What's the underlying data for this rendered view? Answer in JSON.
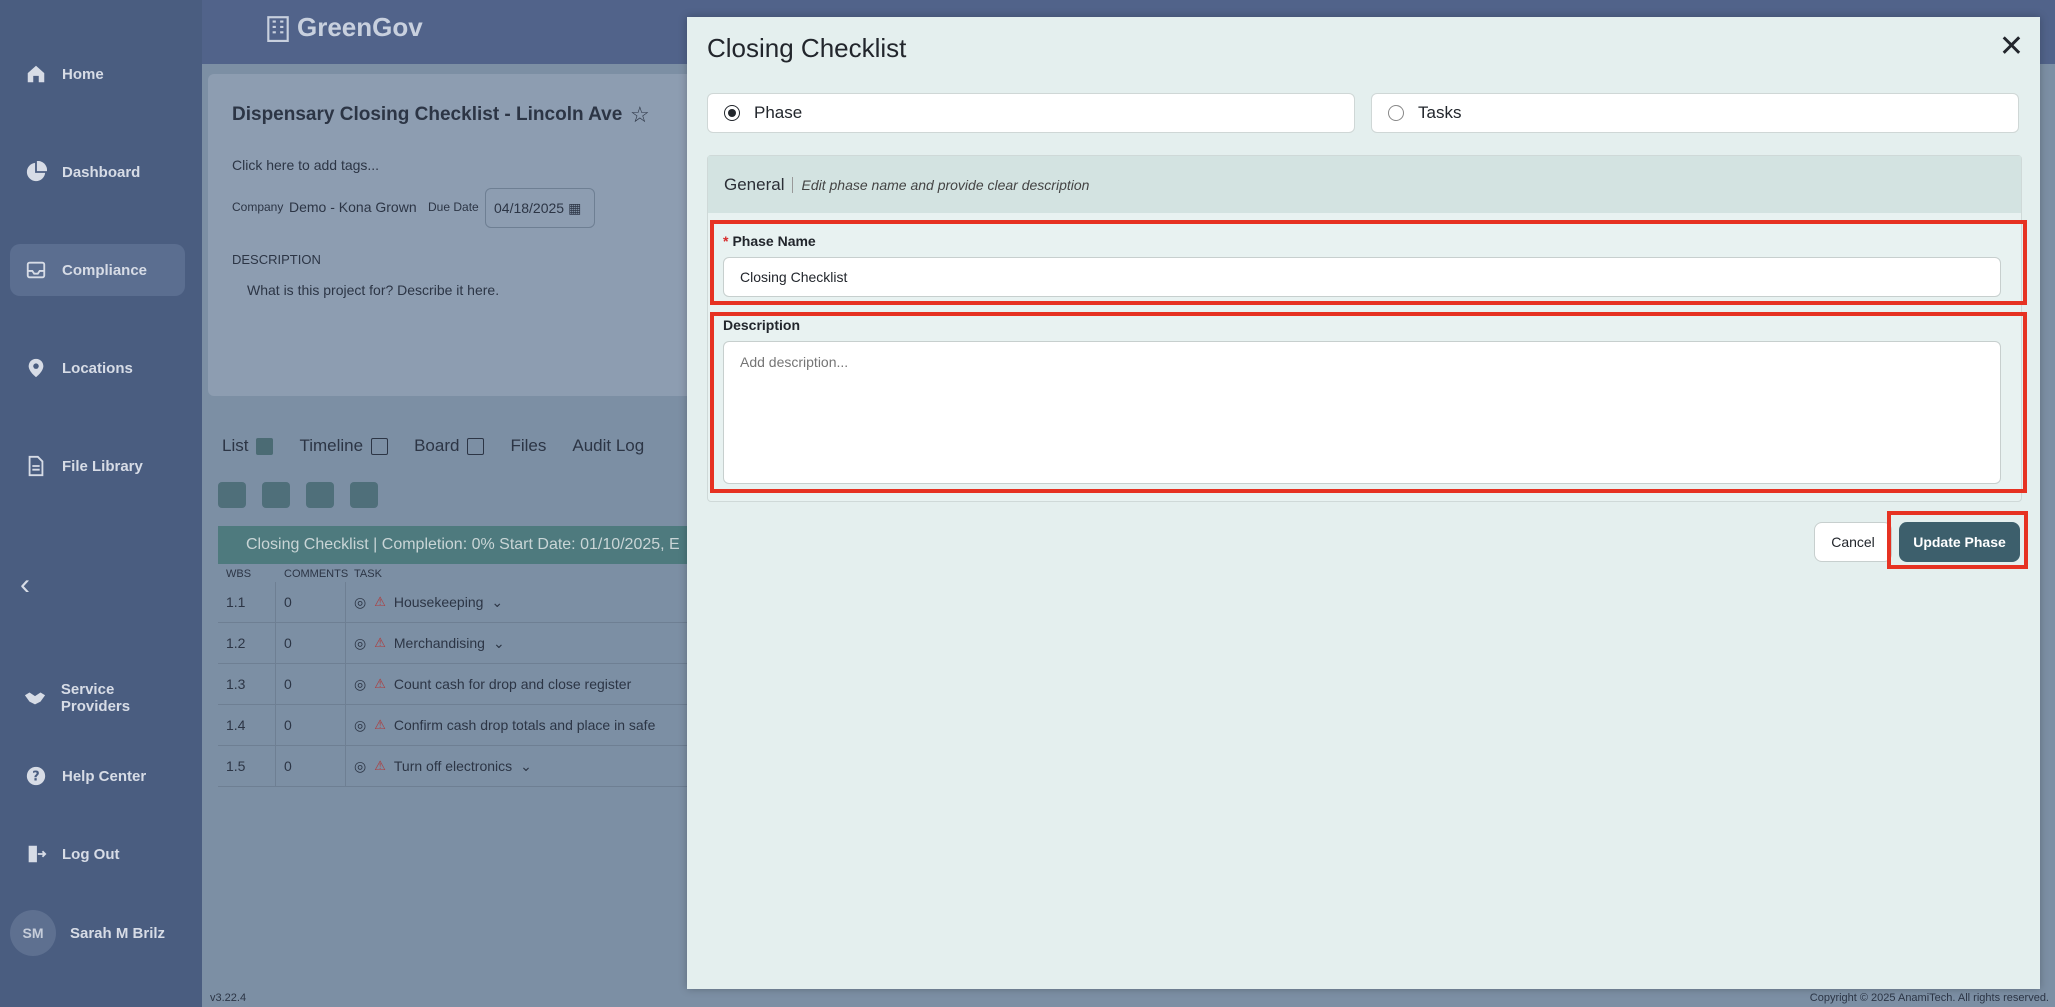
{
  "app": {
    "name": "GreenGov",
    "version": "v3.22.4",
    "copyright": "Copyright © 2025 AnamiTech. All rights reserved."
  },
  "sidebar": {
    "items": [
      {
        "label": "Home",
        "icon": "home-icon"
      },
      {
        "label": "Dashboard",
        "icon": "pie-chart-icon"
      },
      {
        "label": "Compliance",
        "icon": "inbox-icon"
      },
      {
        "label": "Locations",
        "icon": "location-pin-icon"
      },
      {
        "label": "File Library",
        "icon": "file-icon"
      },
      {
        "label": "Service Providers",
        "icon": "handshake-icon"
      },
      {
        "label": "Help Center",
        "icon": "help-icon"
      },
      {
        "label": "Log Out",
        "icon": "logout-icon"
      }
    ],
    "active": "Compliance",
    "user": {
      "initials": "SM",
      "name": "Sarah M Brilz"
    }
  },
  "project": {
    "title": "Dispensary Closing Checklist - Lincoln Ave",
    "tags_hint": "Click here to add tags...",
    "company_label": "Company",
    "company_value": "Demo - Kona Grown",
    "due_label": "Due Date",
    "due_value": "04/18/2025",
    "description_label": "DESCRIPTION",
    "description_hint": "What is this project for? Describe it here."
  },
  "views": {
    "tabs": [
      {
        "label": "List",
        "checked": true
      },
      {
        "label": "Timeline",
        "checked": false
      },
      {
        "label": "Board",
        "checked": false
      },
      {
        "label": "Files"
      },
      {
        "label": "Audit Log"
      }
    ]
  },
  "phase_banner": "Closing Checklist  | Completion: 0%  Start Date: 01/10/2025, E",
  "task_table": {
    "headers": [
      "WBS",
      "COMMENTS",
      "TASK"
    ],
    "rows": [
      {
        "wbs": "1.1",
        "comments": "0",
        "task": "Housekeeping",
        "expand": true
      },
      {
        "wbs": "1.2",
        "comments": "0",
        "task": "Merchandising",
        "expand": true
      },
      {
        "wbs": "1.3",
        "comments": "0",
        "task": "Count cash for drop and close register",
        "expand": false
      },
      {
        "wbs": "1.4",
        "comments": "0",
        "task": "Confirm cash drop totals and place in safe",
        "expand": false
      },
      {
        "wbs": "1.5",
        "comments": "0",
        "task": "Turn off electronics",
        "expand": true
      }
    ]
  },
  "modal": {
    "title": "Closing Checklist",
    "options": [
      {
        "label": "Phase",
        "selected": true
      },
      {
        "label": "Tasks",
        "selected": false
      }
    ],
    "section_title": "General",
    "section_subtitle": "Edit phase name and provide clear description",
    "phase_name_label": "Phase Name",
    "phase_name_value": "Closing Checklist",
    "description_label": "Description",
    "description_placeholder": "Add description...",
    "cancel_label": "Cancel",
    "update_label": "Update Phase",
    "highlight_color": "#e63222"
  }
}
